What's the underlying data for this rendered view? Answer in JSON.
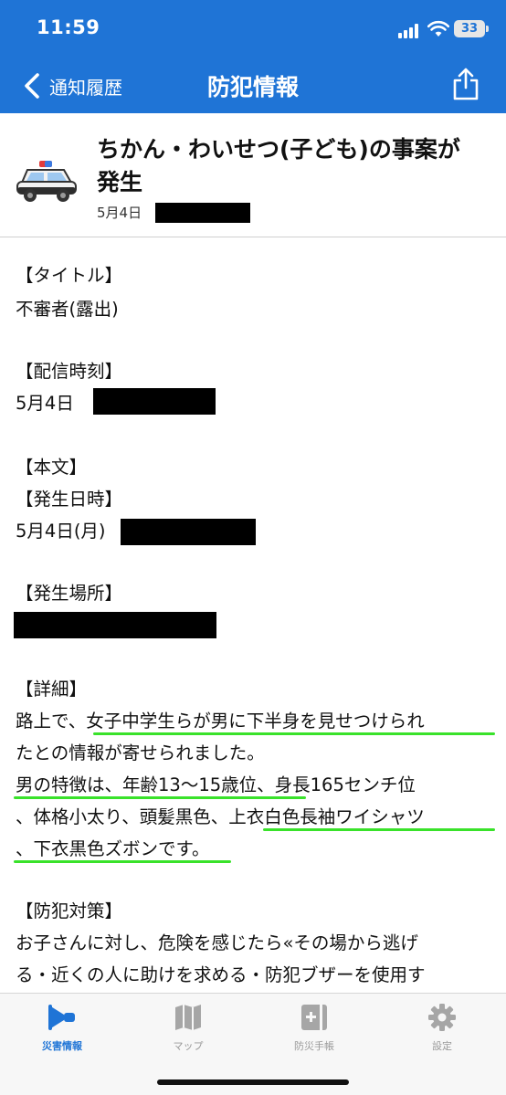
{
  "status_bar": {
    "time": "11:59",
    "battery": "33"
  },
  "nav": {
    "back_label": "通知履歴",
    "title": "防犯情報"
  },
  "incident": {
    "title_line1": "ちかん・わいせつ(子ども)の事案が",
    "title_line2": "発生",
    "date": "5月4日"
  },
  "body": {
    "title_heading": "【タイトル】",
    "title_value": "不審者(露出)",
    "delivery_heading": "【配信時刻】",
    "delivery_date": "5月4日",
    "main_heading": "【本文】",
    "occurred_heading": "【発生日時】",
    "occurred_date": "5月4日(月)",
    "place_heading": "【発生場所】",
    "detail_heading": "【詳細】",
    "detail_lines": [
      "路上で、女子中学生らが男に下半身を見せつけられ",
      "たとの情報が寄せられました。",
      "男の特徴は、年齢13～15歳位、身長165センチ位",
      "、体格小太り、頭髪黒色、上衣白色長袖ワイシャツ",
      "、下衣黒色ズボンです。"
    ],
    "measures_heading": "【防犯対策】",
    "measures_lines": [
      "お子さんに対し、危険を感じたら«その場から逃げ",
      "る・近くの人に助けを求める・防犯ブザーを使用す"
    ]
  },
  "tabs": [
    {
      "label": "災害情報",
      "icon": "megaphone-icon",
      "active": true
    },
    {
      "label": "マップ",
      "icon": "map-icon",
      "active": false
    },
    {
      "label": "防災手帳",
      "icon": "first-aid-notebook-icon",
      "active": false
    },
    {
      "label": "設定",
      "icon": "gear-icon",
      "active": false
    }
  ],
  "colors": {
    "primary": "#1f74d6",
    "highlight": "#39e22a",
    "redaction": "#000000"
  }
}
